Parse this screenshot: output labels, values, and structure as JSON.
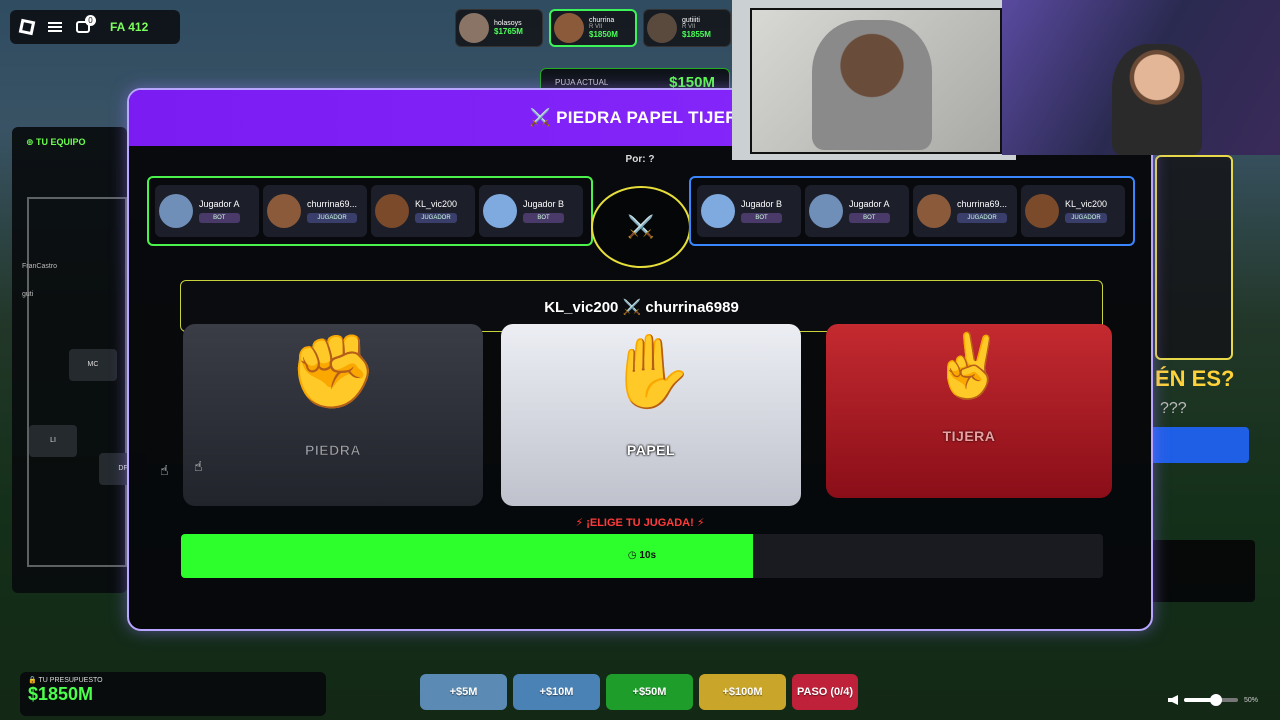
{
  "topbar": {
    "chat_badge": "0",
    "label": "FA 412"
  },
  "players": [
    {
      "name": "holasoys",
      "rank": "",
      "money": "$1765M",
      "active": false
    },
    {
      "name": "churrina",
      "rank": "R VII",
      "money": "$1850M",
      "active": true
    },
    {
      "name": "gutiiiti",
      "rank": "R VII",
      "money": "$1855M",
      "active": false
    }
  ],
  "puja": {
    "label": "PUJA ACTUAL",
    "value": "$150M"
  },
  "team": {
    "header": "⊕ TU EQUIPO",
    "positions": [
      "MC",
      "LI",
      "DF"
    ],
    "discord": [
      "FranCastro",
      "guti"
    ]
  },
  "modal": {
    "title": "⚔️ PIEDRA PAPEL TIJERA",
    "por": "Por: ?",
    "left_lineup": [
      {
        "name": "Jugador A",
        "tag": "BOT"
      },
      {
        "name": "churrina69...",
        "tag": "JUGADOR"
      },
      {
        "name": "KL_vic200",
        "tag": "JUGADOR"
      },
      {
        "name": "Jugador B",
        "tag": "BOT"
      }
    ],
    "right_lineup": [
      {
        "name": "Jugador B",
        "tag": "BOT"
      },
      {
        "name": "Jugador A",
        "tag": "BOT"
      },
      {
        "name": "churrina69...",
        "tag": "JUGADOR"
      },
      {
        "name": "KL_vic200",
        "tag": "JUGADOR"
      }
    ],
    "vs_icon": "⚔️",
    "duel": "KL_vic200 ⚔️ churrina6989",
    "choices": [
      {
        "emoji": "✊",
        "label": "PIEDRA"
      },
      {
        "emoji": "✋",
        "label": "PAPEL"
      },
      {
        "emoji": "✌️",
        "label": "TIJERA"
      }
    ],
    "elige": "⚡ ¡ELIGE TU JUGADA! ⚡",
    "timer": {
      "text": "◷ 10s",
      "fraction": 0.62
    }
  },
  "right_side": {
    "es": "ÉN ES?",
    "q": "???"
  },
  "budget": {
    "label": "🔒 TU PRESUPUESTO",
    "value": "$1850M"
  },
  "bids": [
    "+$5M",
    "+$10M",
    "+$50M",
    "+$100M",
    "PASO (0/4)"
  ],
  "volume": {
    "percent": "50%"
  }
}
